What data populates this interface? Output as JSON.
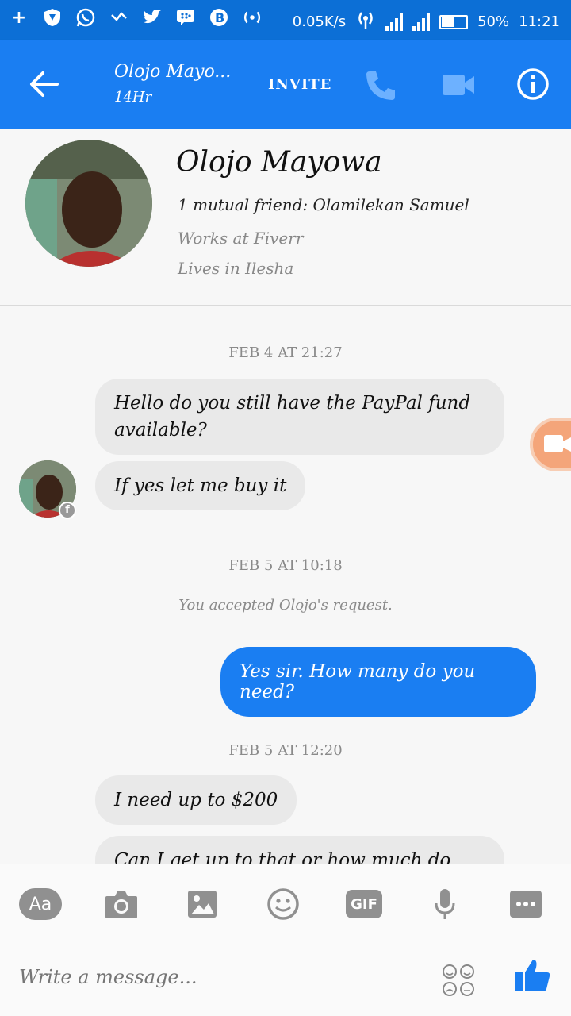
{
  "status_bar": {
    "network_speed": "0.05K/s",
    "battery": "50%",
    "time": "11:21"
  },
  "header": {
    "contact_name": "Olojo Mayo...",
    "active_status": "14Hr",
    "invite_label": "INVITE"
  },
  "profile": {
    "name": "Olojo Mayowa",
    "mutual": "1 mutual friend: Olamilekan Samuel",
    "work": "Works at Fiverr",
    "lives": "Lives in Ilesha"
  },
  "chat": {
    "date1": "FEB 4 AT 21:27",
    "msg1": "Hello do you still have the PayPal fund available?",
    "msg2": "If yes let me buy it",
    "date2": "FEB 5 AT 10:18",
    "notice": "You accepted Olojo's request.",
    "msg3": "Yes sir. How many do you need?",
    "date3": "FEB 5 AT 12:20",
    "msg4": "I need up to  $200",
    "msg5": "Can I get up to that or how much do you"
  },
  "composer": {
    "aa_label": "Aa",
    "gif_label": "GIF",
    "placeholder": "Write a message..."
  },
  "colors": {
    "accent": "#1a7ef2",
    "statusbar": "#0c6fd6",
    "incoming_bubble": "#e9e9e9"
  }
}
